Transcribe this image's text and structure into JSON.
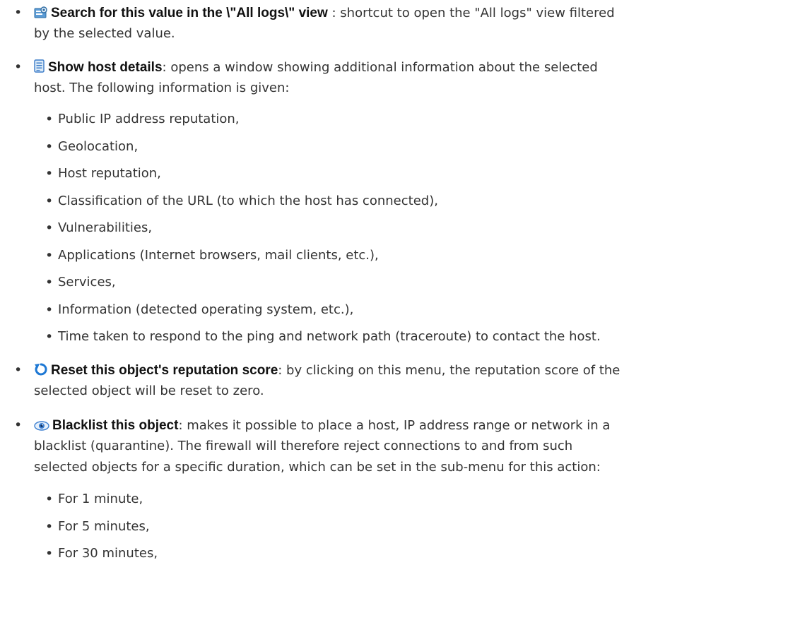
{
  "items": [
    {
      "icon": "search-logs-icon",
      "term": "Search for this value in the \\\"All logs\\\" view",
      "desc_line1": " : shortcut to open the \"All logs\" view filtered",
      "desc_line2": "by the selected value."
    },
    {
      "icon": "host-details-icon",
      "term": "Show host details",
      "desc_line1": ": opens a window showing additional information about the selected",
      "desc_line2": "host. The following information is given:",
      "subitems": [
        "Public IP address reputation,",
        "Geolocation,",
        "Host reputation,",
        "Classification of the URL (to which the host has connected),",
        "Vulnerabilities,",
        "Applications (Internet browsers, mail clients, etc.),",
        "Services,",
        "Information (detected operating system, etc.),",
        "Time taken to respond to the ping and network path (traceroute) to contact the host."
      ]
    },
    {
      "icon": "reset-icon",
      "term": "Reset this object's reputation score",
      "desc_line1": ": by clicking on this menu, the reputation score of the",
      "desc_line2": "selected object will be reset to zero."
    },
    {
      "icon": "eye-icon",
      "term": "Blacklist this object",
      "desc_line1": ": makes it possible to place a host, IP address range or network in a",
      "desc_line2": "blacklist (quarantine). The firewall will therefore reject connections to and from such",
      "desc_line3": "selected objects for a specific duration, which can be set in the sub-menu for this action:",
      "subitems": [
        "For 1 minute,",
        "For 5 minutes,",
        "For 30 minutes,"
      ]
    }
  ],
  "bullet_char": "•"
}
